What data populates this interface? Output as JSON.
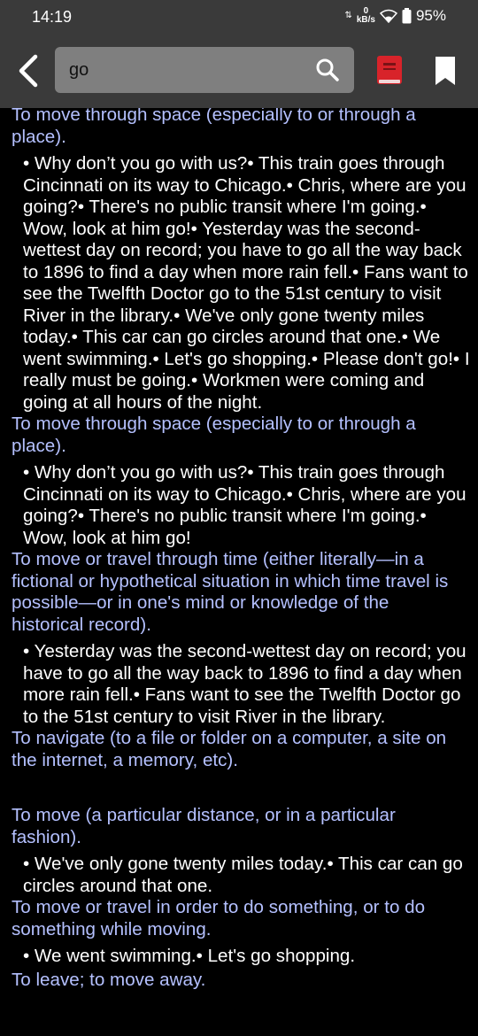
{
  "status_bar": {
    "time": "14:19",
    "net_speed_value": "0",
    "net_speed_unit": "kB/s",
    "battery": "95%",
    "icons": [
      "data-arrows-icon",
      "wifi-icon",
      "battery-icon"
    ]
  },
  "toolbar": {
    "search_value": "go",
    "icons": [
      "back-arrow-icon",
      "search-icon",
      "book-icon",
      "bookmark-icon"
    ],
    "colors": {
      "background": "#3a3a3a",
      "search_box": "#7f7f7f",
      "book": "#d8232a"
    }
  },
  "definitions": [
    {
      "text": "To move through space (especially to or through a place).",
      "examples": "• Why don’t you go with us?• This train goes through Cincinnati on its way to Chicago.• Chris, where are you going?• There's no public transit where I'm going.• Wow, look at him go!• Yesterday was the second-wettest day on record; you have to go all the way back to 1896 to find a day when more rain fell.• Fans want to see the Twelfth Doctor go to the 51st century to visit River in the library.• We've only gone twenty miles today.• This car can go circles around that one.• We went swimming.• Let's go shopping.• Please don't go!• I really must be going.• Workmen were coming and going at all hours of the night."
    },
    {
      "text": "To move through space (especially to or through a place).",
      "examples": "• Why don’t you go with us?• This train goes through Cincinnati on its way to Chicago.• Chris, where are you going?• There's no public transit where I'm going.• Wow, look at him go!"
    },
    {
      "text": "To move or travel through time (either literally—in a fictional or hypothetical situation in which time travel is possible—or in one's mind or knowledge of the historical record).",
      "examples": "• Yesterday was the second-wettest day on record; you have to go all the way back to 1896 to find a day when more rain fell.• Fans want to see the Twelfth Doctor go to the 51st century to visit River in the library."
    },
    {
      "text": "To navigate (to a file or folder on a computer, a site on the internet, a memory, etc).",
      "examples": ""
    },
    {
      "text": "To move (a particular distance, or in a particular fashion).",
      "examples": "• We've only gone twenty miles today.• This car can go circles around that one."
    },
    {
      "text": "To move or travel in order to do something, or to do something while moving.",
      "examples": "• We went swimming.• Let's go shopping."
    },
    {
      "text": "To leave; to move away.",
      "examples": ""
    }
  ],
  "colors": {
    "definition_text": "#b4c0ff",
    "example_text": "#ffffff",
    "page_background": "#000000"
  }
}
